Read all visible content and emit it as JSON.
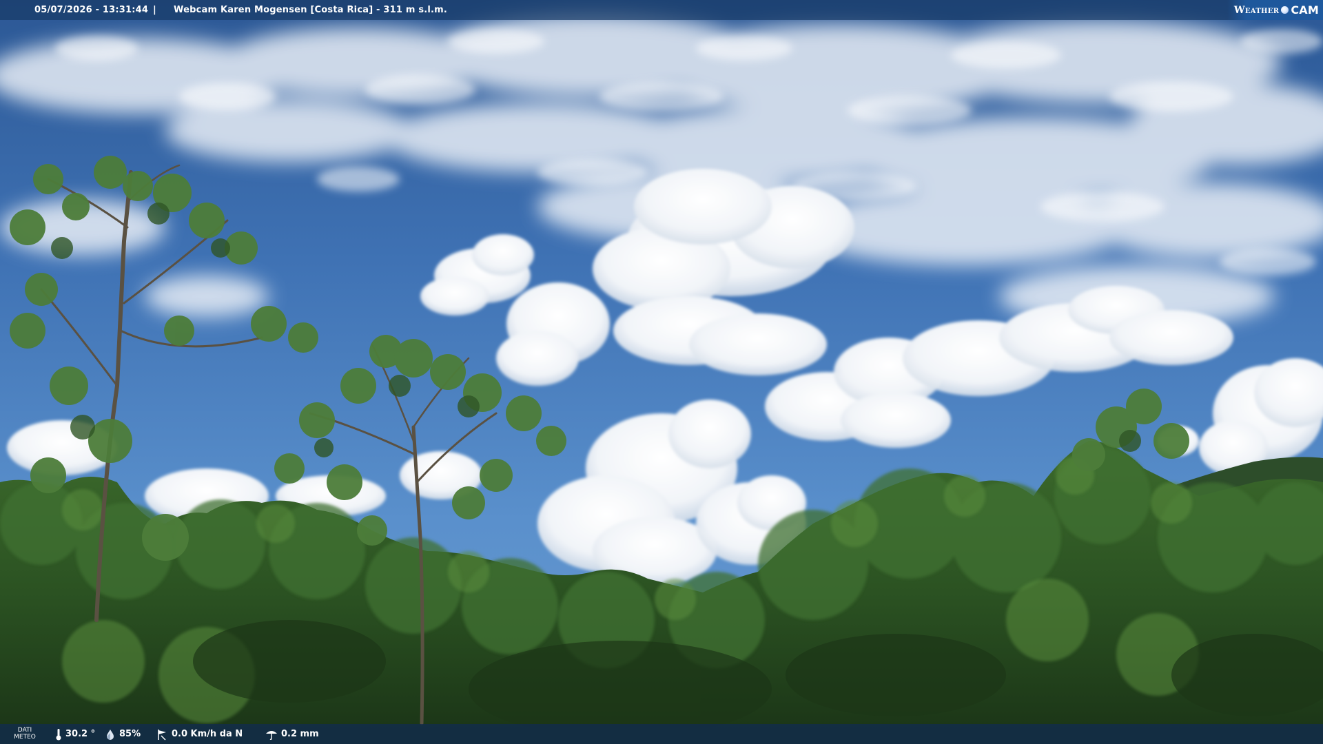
{
  "top_bar": {
    "datetime": "05/07/2026 - 13:31:44",
    "separator": "|",
    "title": "Webcam Karen Mogensen [Costa Rica] - 311 m s.l.m."
  },
  "brand": {
    "weather": "Weather",
    "cam": "CAM"
  },
  "bottom_bar": {
    "label_line1": "DATI",
    "label_line2": "METEO",
    "temperature": "30.2 °",
    "humidity": "85%",
    "wind": "0.0 Km/h da N",
    "rain": "0.2 mm"
  },
  "icons": {
    "temperature": "thermometer-icon",
    "humidity": "droplet-icon",
    "wind": "wind-icon",
    "rain": "rain-icon"
  },
  "colors": {
    "sky_top": "#2f5f9e",
    "sky_mid": "#5b8fcb",
    "foliage_dark": "#1f3d1c",
    "foliage_light": "#4f7f38",
    "bar_bg": "#183a66"
  }
}
